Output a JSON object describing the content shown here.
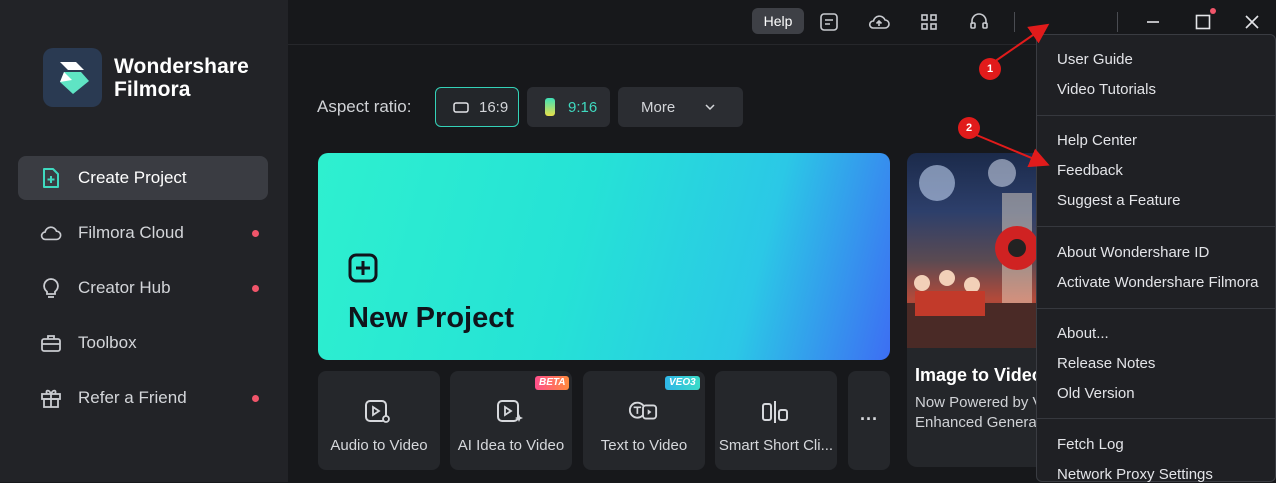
{
  "brand": {
    "line1": "Wondershare",
    "line2": "Filmora"
  },
  "sidebar": {
    "items": [
      {
        "label": "Create Project",
        "icon": "create-project-icon",
        "active": true,
        "dot": false
      },
      {
        "label": "Filmora Cloud",
        "icon": "cloud-icon",
        "active": false,
        "dot": true
      },
      {
        "label": "Creator Hub",
        "icon": "bulb-icon",
        "active": false,
        "dot": true
      },
      {
        "label": "Toolbox",
        "icon": "toolbox-icon",
        "active": false,
        "dot": false
      },
      {
        "label": "Refer a Friend",
        "icon": "gift-icon",
        "active": false,
        "dot": true
      }
    ]
  },
  "topbar": {
    "icons": [
      "send-icon",
      "tasks-icon",
      "cloud-upload-icon",
      "grid-icon",
      "headset-icon"
    ],
    "help_label": "Help"
  },
  "aspect": {
    "label": "Aspect ratio:",
    "options": [
      {
        "label": "16:9",
        "selected": true
      },
      {
        "label": "9:16",
        "selected": false
      }
    ],
    "more_label": "More"
  },
  "hero": {
    "title": "New Project"
  },
  "tools": [
    {
      "label": "Audio to Video",
      "icon": "audio-to-video-icon",
      "badge": ""
    },
    {
      "label": "AI Idea to Video",
      "icon": "ai-idea-icon",
      "badge": "BETA"
    },
    {
      "label": "Text to Video",
      "icon": "text-to-video-icon",
      "badge": "VEO3"
    },
    {
      "label": "Smart Short Cli...",
      "icon": "smart-short-clips-icon",
      "badge": ""
    }
  ],
  "side_card": {
    "title": "Image to Video",
    "subtitle_line1": "Now Powered by V",
    "subtitle_line2": "Enhanced Generati"
  },
  "help_menu": {
    "groups": [
      [
        "User Guide",
        "Video Tutorials"
      ],
      [
        "Help Center",
        "Feedback",
        "Suggest a Feature"
      ],
      [
        "About Wondershare ID",
        "Activate Wondershare Filmora"
      ],
      [
        "About...",
        "Release Notes",
        "Old Version"
      ],
      [
        "Fetch Log",
        "Network Proxy Settings"
      ]
    ]
  },
  "annotations": {
    "step1": "1",
    "step2": "2"
  },
  "colors": {
    "accent": "#34d2b8",
    "annotation": "#e11b1b",
    "notification": "#f0556a"
  }
}
